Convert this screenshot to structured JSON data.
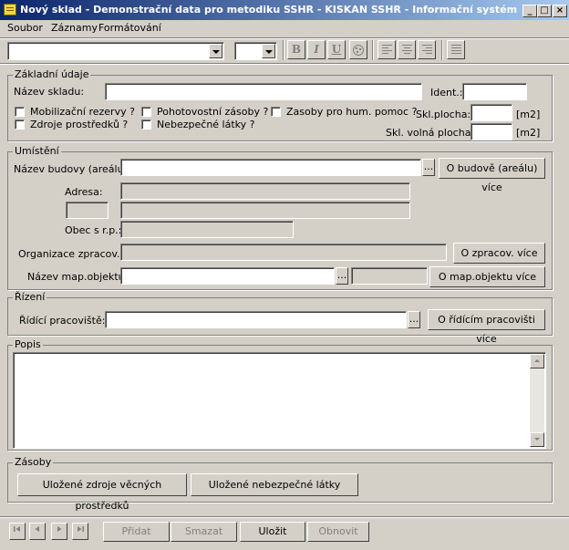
{
  "window": {
    "title": "Nový sklad - Demonstrační data pro metodiku SSHR - KISKAN SSHR - Informační systém pro říze...",
    "min_glyph": "_",
    "max_glyph": "□",
    "close_glyph": "×"
  },
  "menu": {
    "file": "Soubor",
    "records": "Záznamy",
    "format": "Formátování"
  },
  "toolbar": {
    "bold": "B",
    "italic": "I",
    "underline": "U"
  },
  "basic": {
    "legend": "Základní údaje",
    "name_label": "Název skladu:",
    "ident_label": "Ident.:",
    "mobil": "Mobilizační rezervy ?",
    "pohot": "Pohotovostní zásoby ?",
    "hum": "Zasoby pro hum. pomoc ?",
    "zdroje": "Zdroje prostředků ?",
    "nebez": "Nebezpečné látky ?",
    "area_label": "Skl.plocha:",
    "free_area_label": "Skl. volná plocha:",
    "unit": "[m2]"
  },
  "location": {
    "legend": "Umístění",
    "building_label": "Název budovy (areálu):",
    "ellipsis": "...",
    "building_more": "O budově (areálu) více",
    "address_label": "Adresa:",
    "city_label": "Obec s r.p.:",
    "org_label": "Organizace zpracov.:",
    "org_more": "O zpracov. více",
    "map_label": "Název map.objektu:",
    "map_more": "O map.objektu více"
  },
  "control": {
    "legend": "Řízení",
    "workplace_label": "Řídící pracoviště:",
    "workplace_more": "O řídícím pracovišti více"
  },
  "desc": {
    "legend": "Popis"
  },
  "stock": {
    "legend": "Zásoby",
    "btn_sources": "Uložené zdroje věcných prostředků",
    "btn_hazard": "Uložené nebezpečné látky"
  },
  "footer": {
    "add": "Přidat",
    "delete": "Smazat",
    "save": "Uložit",
    "refresh": "Obnovit"
  }
}
